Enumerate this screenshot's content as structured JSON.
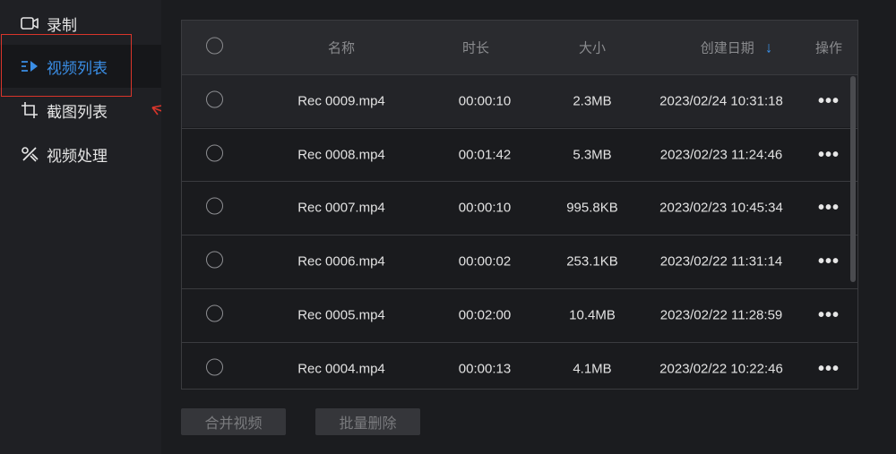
{
  "sidebar": {
    "items": [
      {
        "label": "录制",
        "icon": "video-camera-icon"
      },
      {
        "label": "视频列表",
        "icon": "play-list-icon",
        "active": true
      },
      {
        "label": "截图列表",
        "icon": "screenshot-icon"
      },
      {
        "label": "视频处理",
        "icon": "video-edit-icon"
      }
    ]
  },
  "table": {
    "headers": {
      "name": "名称",
      "duration": "时长",
      "size": "大小",
      "created": "创建日期",
      "actions": "操作"
    },
    "sort_indicator": "↓",
    "rows": [
      {
        "name": "Rec 0009.mp4",
        "duration": "00:00:10",
        "size": "2.3MB",
        "created": "2023/02/24 10:31:18",
        "actions": "•••"
      },
      {
        "name": "Rec 0008.mp4",
        "duration": "00:01:42",
        "size": "5.3MB",
        "created": "2023/02/23 11:24:46",
        "actions": "•••"
      },
      {
        "name": "Rec 0007.mp4",
        "duration": "00:00:10",
        "size": "995.8KB",
        "created": "2023/02/23 10:45:34",
        "actions": "•••"
      },
      {
        "name": "Rec 0006.mp4",
        "duration": "00:00:02",
        "size": "253.1KB",
        "created": "2023/02/22 11:31:14",
        "actions": "•••"
      },
      {
        "name": "Rec 0005.mp4",
        "duration": "00:02:00",
        "size": "10.4MB",
        "created": "2023/02/22 11:28:59",
        "actions": "•••"
      },
      {
        "name": "Rec 0004.mp4",
        "duration": "00:00:13",
        "size": "4.1MB",
        "created": "2023/02/22 10:22:46",
        "actions": "•••"
      }
    ]
  },
  "footer": {
    "merge_label": "合并视频",
    "batch_delete_label": "批量删除"
  },
  "colors": {
    "accent": "#3a8ee6",
    "highlight_border": "#d9352b"
  }
}
